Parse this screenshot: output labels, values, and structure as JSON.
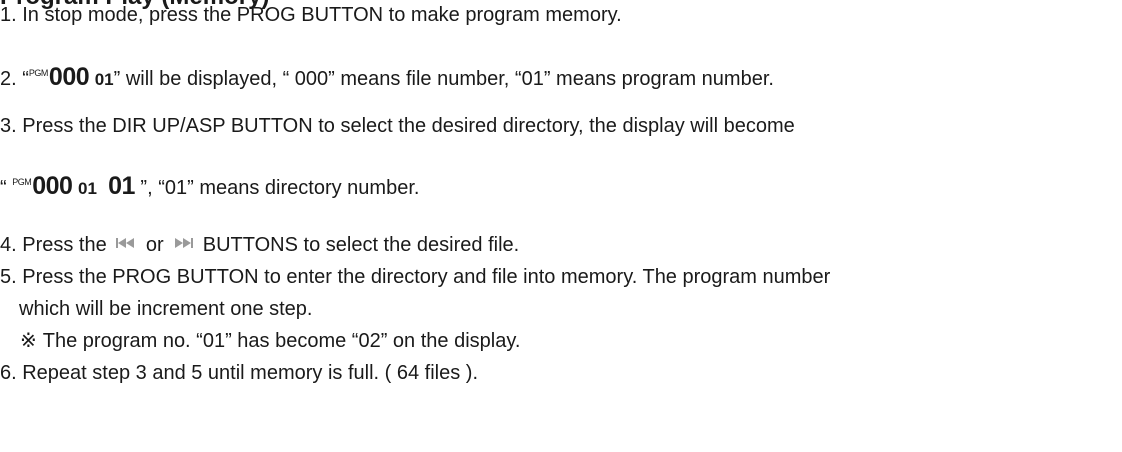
{
  "heading": "Program Play (Memory)",
  "steps": {
    "step1": "1. In stop mode, press the PROG BUTTON to make program memory.",
    "step2": {
      "prefix": "2. “",
      "lcd_pgm": "PGM",
      "lcd_file": "000",
      "lcd_prog": "01",
      "suffix": "” will be displayed, “ 000” means file number, “01” means program number."
    },
    "step3": "3. Press the DIR UP/ASP BUTTON to select the desired directory, the display will become",
    "step3_display": {
      "prefix": "“ ",
      "lcd_pgm": "PGM",
      "lcd_file": "000",
      "lcd_prog": "01",
      "lcd_dir": "01",
      "suffix": " ”, “01” means directory number."
    },
    "step4": {
      "prefix": "4. Press the",
      "middle": "or",
      "suffix": "BUTTONS to select the desired file.",
      "icon_left": "skip-back-icon",
      "icon_right": "skip-forward-icon"
    },
    "step5": "5. Press the PROG BUTTON to enter the directory and file into memory. The program number",
    "step5_cont": "which will be increment one step.",
    "note": {
      "mark": "※",
      "text": "The program no. “01” has become “02” on the display."
    },
    "step6": "6. Repeat step 3 and 5 until memory is full. ( 64 files )."
  }
}
